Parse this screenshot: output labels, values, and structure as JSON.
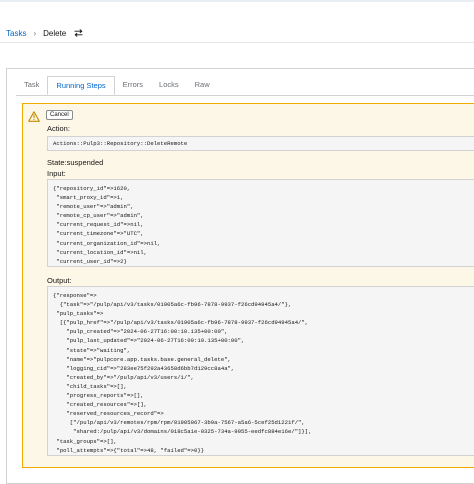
{
  "breadcrumb": {
    "parent": "Tasks",
    "separator": "›",
    "current": "Delete"
  },
  "tabs": [
    {
      "label": "Task"
    },
    {
      "label": "Running Steps"
    },
    {
      "label": "Errors"
    },
    {
      "label": "Locks"
    },
    {
      "label": "Raw"
    }
  ],
  "active_tab": "Running Steps",
  "alert": {
    "cancel_label": "Cancel",
    "action_label": "Action:",
    "action_value": "Actions::Pulp3::Repository::DeleteRemote",
    "state_label": "State:",
    "state_value": "suspended",
    "input_label": "Input:",
    "input_value": "{\"repository_id\"=>1620,\n \"smart_proxy_id\"=>1,\n \"remote_user\"=>\"admin\",\n \"remote_cp_user\"=>\"admin\",\n \"current_request_id\"=>nil,\n \"current_timezone\"=>\"UTC\",\n \"current_organization_id\"=>nil,\n \"current_location_id\"=>nil,\n \"current_user_id\"=>2}",
    "output_label": "Output:",
    "output_value": "{\"response\"=>\n  {\"task\"=>\"/pulp/api/v3/tasks/01905a6c-fb96-7878-9937-f26cd94945a4/\"},\n \"pulp_tasks\"=>\n  [{\"pulp_href\"=>\"/pulp/api/v3/tasks/01905a6c-fb96-7878-9937-f26cd94945a4/\",\n    \"pulp_created\"=>\"2024-06-27T16:00:10.135+00:00\",\n    \"pulp_last_updated\"=>\"2024-06-27T16:00:10.135+00:00\",\n    \"state\"=>\"waiting\",\n    \"name\"=>\"pulpcore.app.tasks.base.general_delete\",\n    \"logging_cid\"=>\"283ee75f292a43658d6bb7d129cc8a4a\",\n    \"created_by\"=>\"/pulp/api/v3/users/1/\",\n    \"child_tasks\"=>[],\n    \"progress_reports\"=>[],\n    \"created_resources\"=>[],\n    \"reserved_resources_record\"=>\n     [\"/pulp/api/v3/remotes/rpm/rpm/01905067-3b9a-7567-a5a6-5cef25d1221f/\",\n      \"shared:/pulp/api/v3/domains/018c5a1e-0325-734a-9055-eedfc884e16e/\"]}],\n \"task_groups\"=>[],\n \"poll_attempts\"=>{\"total\"=>48, \"failed\"=>0}}"
  },
  "colors": {
    "link": "#0066cc",
    "warning_border": "#f0ab00",
    "warning_bg": "#fdf7e7"
  },
  "icons": {
    "switch": "switch-arrows-icon",
    "warning": "warning-triangle-icon"
  }
}
